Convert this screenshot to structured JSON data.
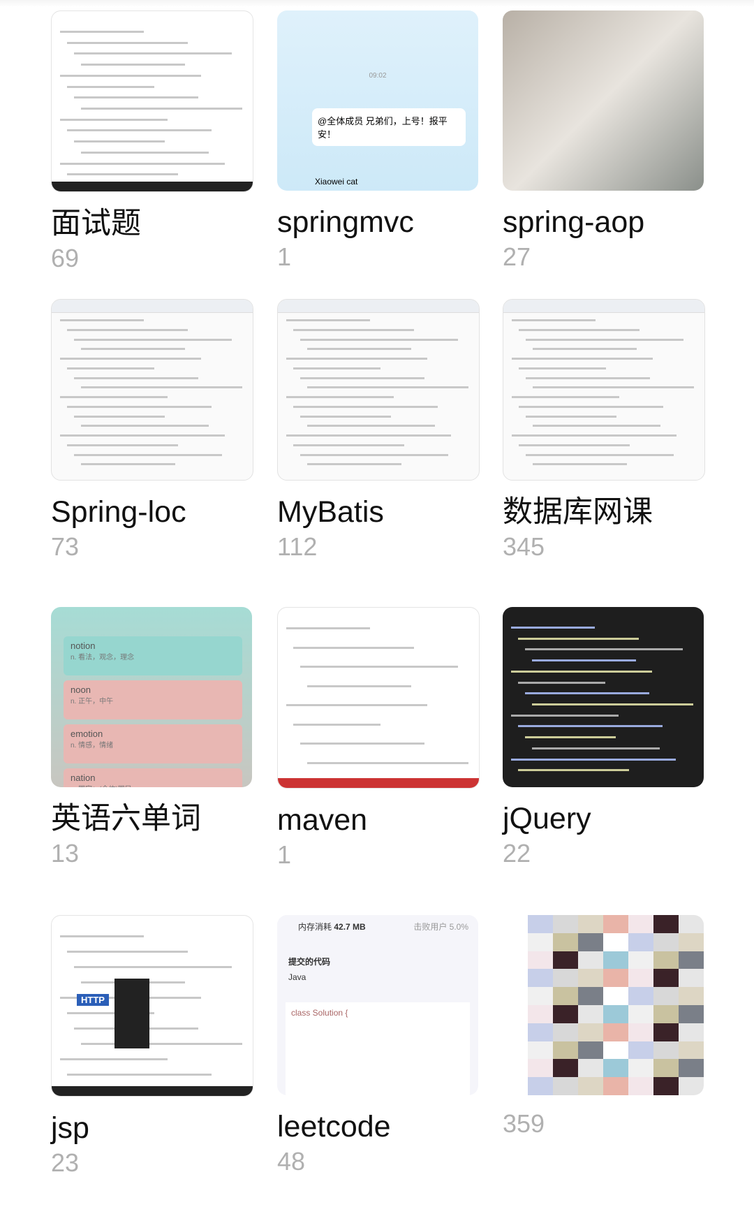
{
  "albums": [
    {
      "title": "面试题",
      "count": "69",
      "thumb": "document-hashtable"
    },
    {
      "title": "springmvc",
      "count": "1",
      "thumb": "chat"
    },
    {
      "title": "spring-aop",
      "count": "27",
      "thumb": "photo"
    },
    {
      "title": "Spring-loc",
      "count": "73",
      "thumb": "code"
    },
    {
      "title": "MyBatis",
      "count": "112",
      "thumb": "code"
    },
    {
      "title": "数据库网课",
      "count": "345",
      "thumb": "code"
    },
    {
      "title": "英语六单词",
      "count": "13",
      "thumb": "vocabulary"
    },
    {
      "title": "maven",
      "count": "1",
      "thumb": "slides"
    },
    {
      "title": "jQuery",
      "count": "22",
      "thumb": "dark-code"
    },
    {
      "title": "jsp",
      "count": "23",
      "thumb": "diagram"
    },
    {
      "title": "leetcode",
      "count": "48",
      "thumb": "leetcode"
    },
    {
      "title": "",
      "count": "359",
      "thumb": "blurred"
    }
  ],
  "vocab": [
    {
      "word": "notion",
      "meaning": "n. 看法，观念，理念"
    },
    {
      "word": "noon",
      "meaning": "n. 正午，中午"
    },
    {
      "word": "emotion",
      "meaning": "n. 情感，情绪"
    },
    {
      "word": "nation",
      "meaning": "n. 国家；(全体)国民"
    }
  ],
  "leetcode": {
    "mem_label": "内存消耗",
    "mem": "42.7 MB",
    "beat": "击败用户 5.0%",
    "submitted": "提交的代码",
    "lang": "Java",
    "code": "class Solution {"
  },
  "chat": {
    "name": "Xiaowei cat",
    "msg": "@全体成员 兄弟们，上号！报平安！",
    "time": "09:02"
  }
}
